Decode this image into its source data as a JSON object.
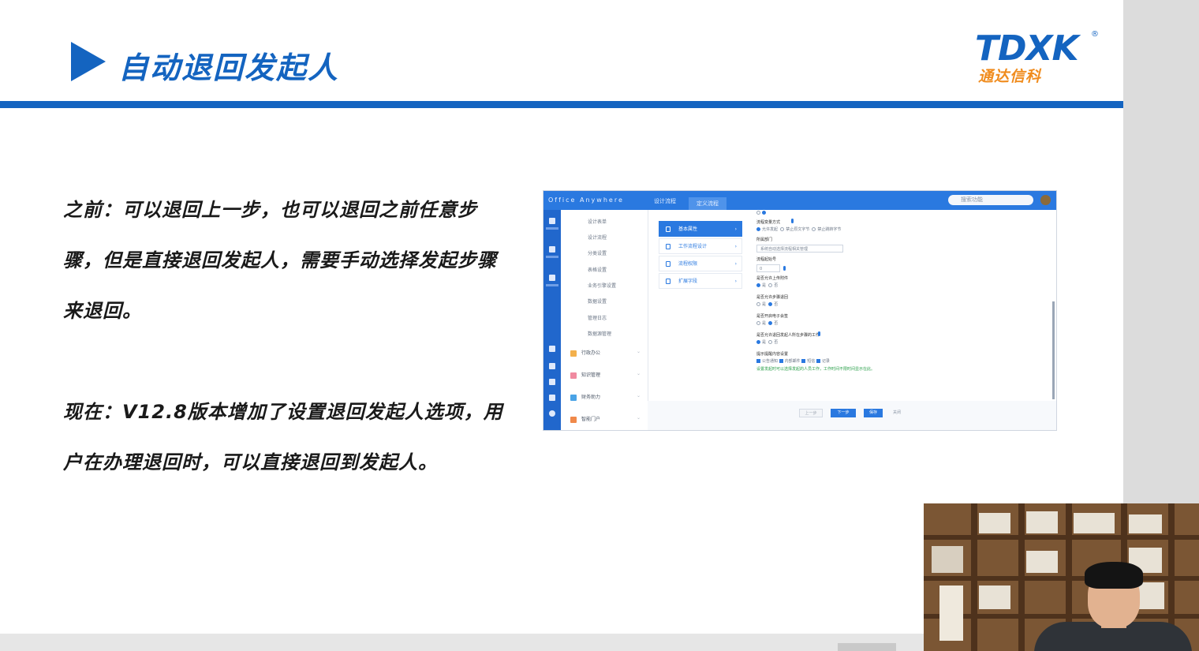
{
  "slide": {
    "title": "自动退回发起人",
    "logo_main": "TDXK",
    "logo_reg": "®",
    "logo_sub": "通达信科",
    "before_text": "之前：可以退回上一步，也可以退回之前任意步骤，但是直接退回发起人，需要手动选择发起步骤来退回。",
    "now_text": "现在：V12.8版本增加了设置退回发起人选项，用户在办理退回时，可以直接退回到发起人。"
  },
  "screenshot": {
    "brand": "Office Anywhere",
    "tabs": [
      "设计流程",
      "定义流程"
    ],
    "search_placeholder": "搜索功能",
    "side_items": [
      "设计表单",
      "设计流程",
      "分类设置",
      "表格设置",
      "业务引擎设置",
      "数据设置",
      "管理日志",
      "数据源管理"
    ],
    "side_groups": [
      "行政办公",
      "知识管理",
      "财务助力",
      "智能门户"
    ],
    "menu_items": [
      "基本属性",
      "工作流程设计",
      "流程权限",
      "扩展字段"
    ],
    "form": {
      "f1_label": "流程变量方式",
      "f1_opts": [
        "允许发起",
        "禁止原文字节",
        "禁止跳转字节"
      ],
      "f2_label": "所属部门",
      "f2_value": "系统自动选择流程相关管理",
      "f3_label": "流程起始号",
      "f3_value": "0",
      "f4_label": "是否允许上传附件",
      "f5_label": "是否允许步骤退回",
      "f6_label": "是否开启电子会签",
      "f7_label": "是否允许退回发起人所在步骤的工作",
      "yes": "是",
      "no": "否",
      "f8_label": "提示提醒内容设置",
      "f8_opts": [
        "公告通知",
        "内部邮件",
        "短信",
        "记录"
      ],
      "note": "设置发起时可以选择发起的人员工作，工作时间不限时间显示在此。"
    },
    "buttons": {
      "prev": "上一步",
      "next": "下一步",
      "save": "保存",
      "close": "关闭"
    }
  },
  "colors": {
    "brand_blue": "#1464c0",
    "logo_orange": "#f08c1e",
    "oa_blue": "#2a79e0"
  }
}
